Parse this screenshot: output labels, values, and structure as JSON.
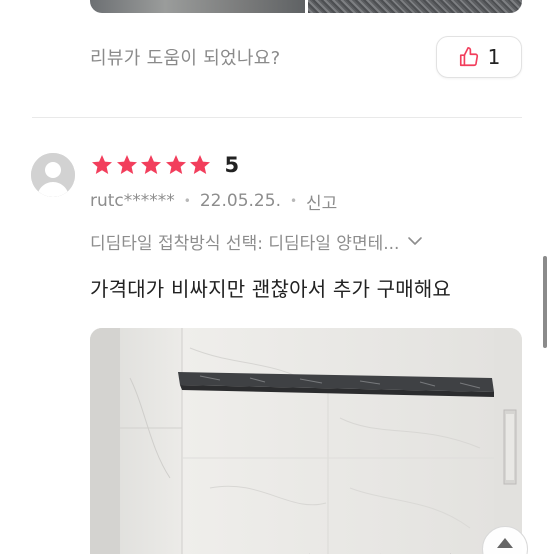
{
  "prev_review": {
    "helpful_question": "리뷰가 도움이 되었나요?",
    "like_count": "1",
    "like_icon": "thumbs-up-icon"
  },
  "review": {
    "rating": 5,
    "rating_label": "5",
    "star_color": "#f23e5c",
    "author": "rutc******",
    "date": "22.05.25.",
    "report_label": "신고",
    "option_text": "디딤타일 접착방식 선택: 디딤타일 양면테...",
    "body": "가격대가 비싸지만 괜찮아서 추가 구매해요"
  },
  "colors": {
    "accent": "#f23e5c",
    "muted_text": "#8d8d8d",
    "divider": "#e9e9e9"
  },
  "icons": {
    "chevron": "chevron-down-icon",
    "scroll_top": "arrow-up-icon"
  }
}
